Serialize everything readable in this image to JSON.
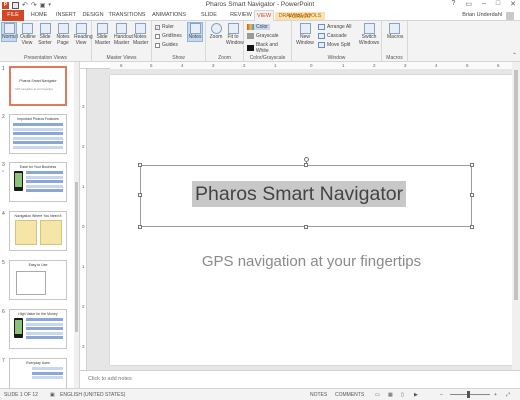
{
  "window": {
    "title": "Pharos Smart Navigator - PowerPoint",
    "controls": [
      "?",
      "▭",
      "–",
      "□",
      "✕"
    ]
  },
  "tabs": {
    "file": "FILE",
    "items": [
      "HOME",
      "INSERT",
      "DESIGN",
      "TRANSITIONS",
      "ANIMATIONS",
      "SLIDE SHOW",
      "REVIEW",
      "VIEW",
      "FORMAT"
    ],
    "active": "VIEW",
    "context_header": "DRAWING TOOLS",
    "user_name": "Brian Underdahl"
  },
  "ribbon": {
    "presentation_views": {
      "label": "Presentation Views",
      "buttons": [
        "Normal",
        "Outline View",
        "Slide Sorter",
        "Notes Page",
        "Reading View"
      ]
    },
    "master_views": {
      "label": "Master Views",
      "buttons": [
        "Slide Master",
        "Handout Master",
        "Notes Master"
      ]
    },
    "show": {
      "label": "Show",
      "checkboxes": [
        {
          "label": "Ruler",
          "checked": true
        },
        {
          "label": "Gridlines",
          "checked": false
        },
        {
          "label": "Guides",
          "checked": false
        }
      ],
      "notes_button": "Notes"
    },
    "zoom": {
      "label": "Zoom",
      "buttons": [
        "Zoom",
        "Fit to Window"
      ]
    },
    "color_grayscale": {
      "label": "Color/Grayscale",
      "options": [
        "Color",
        "Grayscale",
        "Black and White"
      ]
    },
    "window": {
      "label": "Window",
      "new_window": "New Window",
      "options": [
        "Arrange All",
        "Cascade",
        "Move Split"
      ],
      "switch_windows": "Switch Windows"
    },
    "macros": {
      "label": "Macros",
      "button": "Macros"
    }
  },
  "thumbnails": [
    {
      "num": "1",
      "title": "Pharos Smart Navigator",
      "subtitle": "GPS navigation at your fingertips",
      "selected": true
    },
    {
      "num": "2",
      "title": "Important Pharos Features",
      "selected": false
    },
    {
      "num": "3",
      "title": "Ease for Your Business",
      "selected": false
    },
    {
      "num": "4",
      "title": "Navigation Where You Need It",
      "selected": false
    },
    {
      "num": "5",
      "title": "Easy to Use",
      "selected": false
    },
    {
      "num": "6",
      "title": "High Value for the Money",
      "selected": false
    },
    {
      "num": "7",
      "title": "Everyday Uses",
      "selected": false
    }
  ],
  "ruler": {
    "h_ticks": [
      "6",
      "5",
      "4",
      "3",
      "2",
      "1",
      "0",
      "1",
      "2",
      "3",
      "4",
      "5",
      "6"
    ],
    "v_ticks": [
      "3",
      "2",
      "1",
      "0",
      "1",
      "2",
      "3"
    ]
  },
  "slide": {
    "title": "Pharos Smart Navigator",
    "subtitle": "GPS navigation at your fingertips"
  },
  "notes_placeholder": "Click to add notes",
  "status": {
    "slide_of": "SLIDE 1 OF 12",
    "language": "ENGLISH (UNITED STATES)",
    "notes": "NOTES",
    "comments": "COMMENTS"
  },
  "colors": {
    "accent": "#d24726",
    "context": "#f9e4b0",
    "selected_view": "#c5d9ef"
  }
}
